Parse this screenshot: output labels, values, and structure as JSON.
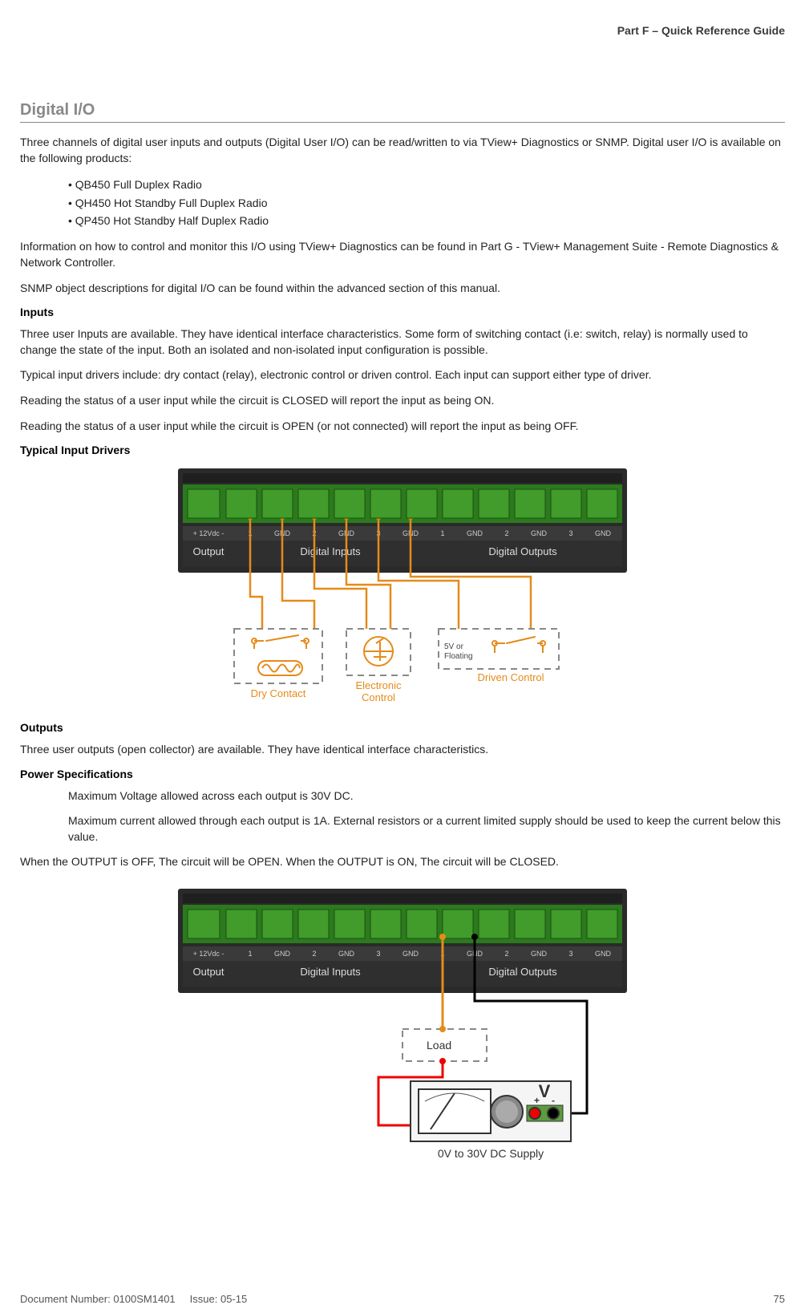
{
  "header": {
    "part": "Part F – Quick Reference Guide"
  },
  "section_title": "Digital I/O",
  "intro1": "Three channels of digital user inputs and outputs (Digital User I/O) can be read/written to via TView+ Diagnostics or SNMP. Digital user I/O is available on the following products:",
  "products": [
    "QB450 Full Duplex Radio",
    "QH450 Hot Standby Full Duplex Radio",
    "QP450 Hot Standby Half Duplex Radio"
  ],
  "intro2": "Information on how to control and monitor this I/O using TView+ Diagnostics can be found in Part G - TView+ Management Suite - Remote Diagnostics & Network Controller.",
  "intro3": "SNMP object descriptions for digital I/O can be found within the advanced section of this manual.",
  "inputs_heading": "Inputs",
  "inputs_p1": "Three user Inputs are available. They have identical interface characteristics. Some form of switching contact (i.e: switch, relay) is normally used to change the state of the input. Both an isolated and non-isolated input configuration is possible.",
  "inputs_p2": "Typical input drivers include: dry contact (relay), electronic control or driven control. Each input can support either type of driver.",
  "inputs_p3": "Reading the status of a user input while the circuit is CLOSED will report the input as being ON.",
  "inputs_p4": "Reading the status of a user input while the circuit is OPEN (or not connected) will report the input as being OFF.",
  "typical_drivers_heading": "Typical Input Drivers",
  "diagram1_labels": {
    "pin_labels": [
      "+ 12Vdc -",
      "1",
      "GND",
      "2",
      "GND",
      "3",
      "GND",
      "1",
      "GND",
      "2",
      "GND",
      "3",
      "GND"
    ],
    "groups": [
      "Output",
      "Digital Inputs",
      "Digital Outputs"
    ],
    "driver1": "Dry Contact",
    "driver2": "Electronic Control",
    "driver3": "Driven Control",
    "note": "5V or Floating"
  },
  "outputs_heading": "Outputs",
  "outputs_p1": "Three user outputs (open collector) are available. They have identical interface characteristics.",
  "power_spec_heading": "Power Specifications",
  "power_spec_p1": "Maximum Voltage allowed across each output is 30V DC.",
  "power_spec_p2": "Maximum current allowed through each output is 1A. External resistors or a current limited supply should be used to keep the current below this value.",
  "outputs_p2": "When the OUTPUT is OFF, The circuit will be OPEN. When the OUTPUT is ON, The circuit will be CLOSED.",
  "diagram2_labels": {
    "load": "Load",
    "v": "V",
    "pm": "+  -",
    "supply": "0V to 30V DC Supply"
  },
  "footer": {
    "docnum": "Document Number: 0100SM1401",
    "issue": "Issue: 05-15",
    "page": "75"
  }
}
